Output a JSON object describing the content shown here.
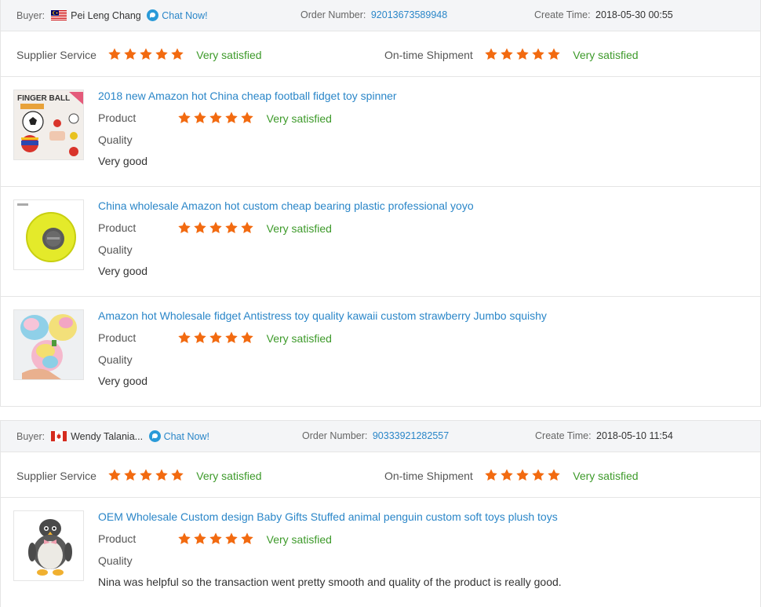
{
  "orders": [
    {
      "buyer_label": "Buyer:",
      "buyer_name": "Pei Leng Chang",
      "chat_label": "Chat Now!",
      "order_label": "Order Number:",
      "order_number": "92013673589948",
      "time_label": "Create Time:",
      "create_time": "2018-05-30 00:55",
      "flag": "malaysia-flag",
      "supplier_label": "Supplier Service",
      "supplier_rating_text": "Very satisfied",
      "supplier_stars": 5,
      "shipment_label": "On-time Shipment",
      "shipment_rating_text": "Very satisfied",
      "shipment_stars": 5,
      "items": [
        {
          "title": "2018 new Amazon hot China cheap football fidget toy spinner",
          "product_label": "Product",
          "product_rating_text": "Very satisfied",
          "product_stars": 5,
          "quality_label": "Quality",
          "comment": "Very good",
          "thumb_text": "FINGER BALL"
        },
        {
          "title": "China wholesale Amazon hot custom cheap bearing plastic professional yoyo",
          "product_label": "Product",
          "product_rating_text": "Very satisfied",
          "product_stars": 5,
          "quality_label": "Quality",
          "comment": "Very good"
        },
        {
          "title": "Amazon hot Wholesale fidget Antistress toy quality kawaii custom strawberry Jumbo squishy",
          "product_label": "Product",
          "product_rating_text": "Very satisfied",
          "product_stars": 5,
          "quality_label": "Quality",
          "comment": "Very good"
        }
      ]
    },
    {
      "buyer_label": "Buyer:",
      "buyer_name": "Wendy Talania...",
      "chat_label": "Chat Now!",
      "order_label": "Order Number:",
      "order_number": "90333921282557",
      "time_label": "Create Time:",
      "create_time": "2018-05-10 11:54",
      "flag": "canada-flag",
      "supplier_label": "Supplier Service",
      "supplier_rating_text": "Very satisfied",
      "supplier_stars": 5,
      "shipment_label": "On-time Shipment",
      "shipment_rating_text": "Very satisfied",
      "shipment_stars": 5,
      "items": [
        {
          "title": "OEM Wholesale Custom design Baby Gifts Stuffed animal penguin custom soft toys plush toys",
          "product_label": "Product",
          "product_rating_text": "Very satisfied",
          "product_stars": 5,
          "quality_label": "Quality",
          "comment": "Nina was helpful so the transaction went pretty smooth and quality of the product is really good."
        }
      ]
    }
  ],
  "colors": {
    "star": "#f26a10",
    "satisfied": "#3d9a2a",
    "link": "#2a86c8",
    "header_bg": "#f4f5f7"
  }
}
